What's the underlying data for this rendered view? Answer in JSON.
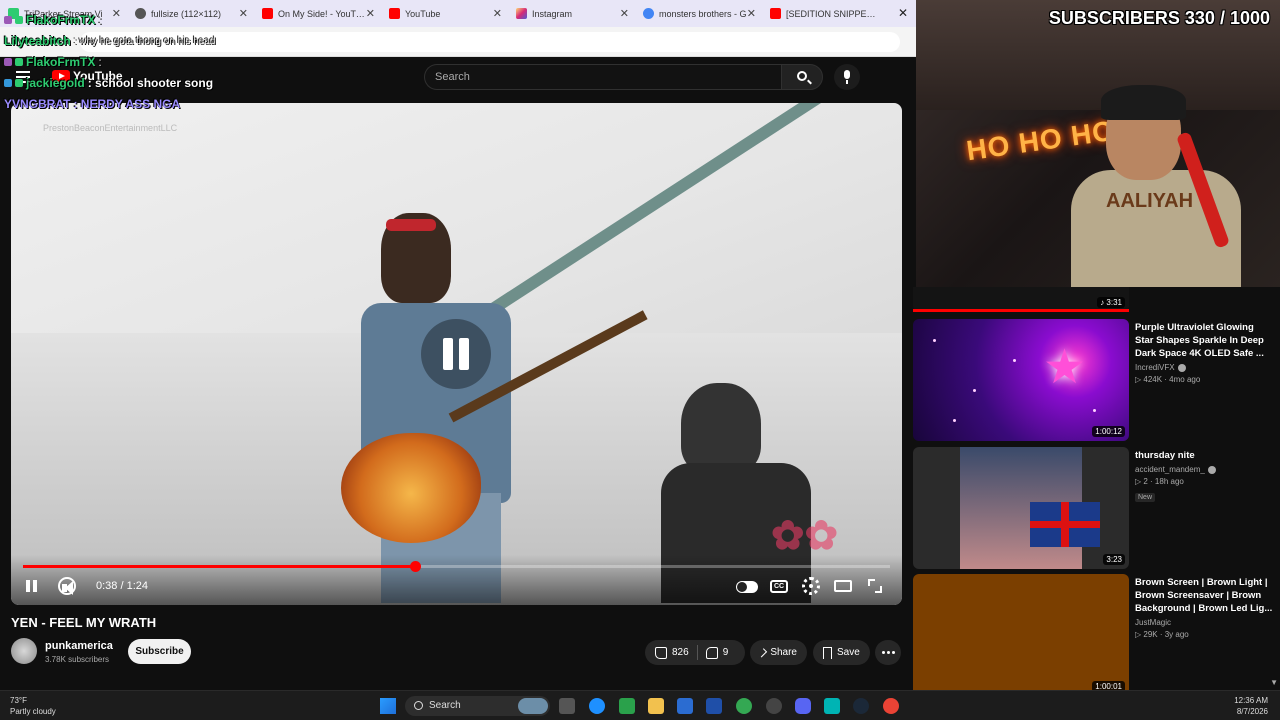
{
  "browser": {
    "tabs": [
      {
        "title": "TriParker Stream Vi",
        "color": "#2ecc71"
      },
      {
        "title": "fullsize (112×112)",
        "color": "#555555"
      },
      {
        "title": "On My Side! - YouTube",
        "color": "#ff0000"
      },
      {
        "title": "YouTube",
        "color": "#ff0000"
      },
      {
        "title": "Instagram",
        "color": "#d6249f"
      },
      {
        "title": "monsters brothers - G",
        "color": "#4285f4"
      },
      {
        "title": "[SEDITION SNIPPET] N",
        "color": "#ff0000"
      }
    ]
  },
  "youtube": {
    "logo": "YouTube",
    "search_placeholder": "Search"
  },
  "chat": [
    {
      "user": "FlakoFrmTX",
      "message": ":",
      "user_color": "#2ecc71"
    },
    {
      "user": "Lilyteabitch",
      "message": ": why he gota thong on his head",
      "user_color": "#2ecc71"
    },
    {
      "user": "FlakoFrmTX",
      "message": ":",
      "user_color": "#2ecc71"
    },
    {
      "user": "jackiegold",
      "message": ": school shooter song",
      "user_color": "#2ecc71"
    },
    {
      "user": "YVNGBRAT",
      "message": ": NERDY ASS NGA",
      "user_color": "#9b8cff"
    }
  ],
  "player": {
    "channel_overlay": "PrestonBeaconEntertainmentLLC",
    "time_current": "0:38",
    "time_total": "1:24",
    "time_display": "0:38 / 1:24",
    "progress": 0.452,
    "cc_label": "CC"
  },
  "video": {
    "title": "YEN - FEEL MY WRATH",
    "channel": "punkamerica",
    "subscribers": "3.78K subscribers",
    "subscribe_label": "Subscribe",
    "likes": "826",
    "dislikes": "9",
    "share_label": "Share",
    "save_label": "Save"
  },
  "stream": {
    "subs_counter": "SUBSCRIBERS 330 / 1000",
    "neon_sign": "HO HO HO",
    "shirt_text": "AALIYAH"
  },
  "sidebar": {
    "top_duration": "3:31",
    "items": [
      {
        "title": "Purple Ultraviolet Glowing Star Shapes Sparkle In Deep Dark Space 4K OLED Safe ...",
        "channel": "IncrediVFX",
        "verified": true,
        "meta": "424K · 4mo ago",
        "duration": "1:00:12",
        "new": ""
      },
      {
        "title": "thursday nite",
        "channel": "accident_mandem_",
        "verified": true,
        "meta": "2 · 18h ago",
        "duration": "3:23",
        "new": "New"
      },
      {
        "title": "Brown Screen | Brown Light | Brown Screensaver | Brown Background | Brown Led Lig...",
        "channel": "JustMagic",
        "verified": false,
        "meta": "29K · 3y ago",
        "duration": "1:00:01",
        "new": ""
      }
    ]
  },
  "taskbar": {
    "temp": "73°F",
    "weather": "Partly cloudy",
    "search_label": "Search",
    "time": "12:36 AM",
    "date": "8/7/2026"
  }
}
